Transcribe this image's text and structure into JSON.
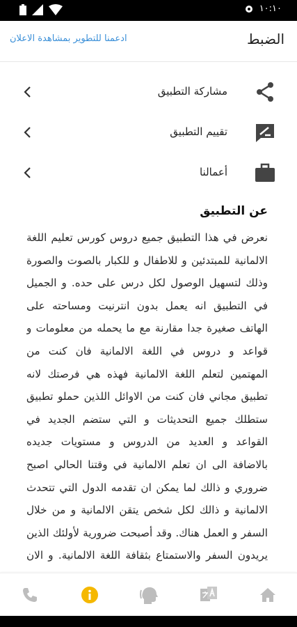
{
  "status_bar": {
    "time": "١٠:١٠"
  },
  "app_bar": {
    "title": "الضبط",
    "ad_link": "ادعمنا للتطوير بمشاهدة الاعلان"
  },
  "menu": [
    {
      "label": "مشاركة التطبيق",
      "icon": "share-icon"
    },
    {
      "label": "تقييم التطبيق",
      "icon": "rate-icon"
    },
    {
      "label": "أعمالنا",
      "icon": "briefcase-icon"
    }
  ],
  "about": {
    "title": "عن التطبيق",
    "body": "نعرض في هذا التطبيق جميع دروس كورس تعليم اللغة الالمانية للمبتدئين و للاطفال و للكبار بالصوت والصورة وذلك لتسهيل الوصول لكل درس على حده. و الجميل في التطبيق انه يعمل بدون انترنيت ومساحته على الهاتف صغيرة جدا مقارنة مع ما يحمله من معلومات و قواعد و دروس في اللغة الالمانية فان كنت من المهتمين لتعلم اللغة الالمانية فهذه هي فرصتك لانه تطبيق مجاني فان كنت من الاوائل اللذين حملو تطبيق ستطلك جميع التحديثات و التي ستضم الجديد في القواعد و العديد من الدروس و مستويات جديده بالاضافة الى ان تعلم الالمانية في وقتنا الحالي اصبح ضروري و ذالك لما يمكن ان تقدمه الدول التي تتحدث الالمانية و ذالك لكل شخص يتقن الالمانية و من خلال السفر و العمل هناك. وقد أصبحت ضرورية لأولئك الذين يريدون السفر والاستمتاع بثقافة اللغة الالمانية. و الان اتركيكم مع خصائص التطبيق الكثيرة لكن لعدم تشتيت انتباهكم ذكرنا القليل منها و الاستماع للغة الحقيقية للتطبيق خصائص التطبيق"
  },
  "colors": {
    "accent": "#f5b800",
    "link": "#3a8fd8",
    "icon": "#444444",
    "nav_icon": "#bdbdbd"
  },
  "bottom_nav": [
    {
      "name": "home-icon",
      "active": false
    },
    {
      "name": "translate-icon",
      "active": false
    },
    {
      "name": "speaking-icon",
      "active": false
    },
    {
      "name": "info-icon",
      "active": true
    },
    {
      "name": "phone-icon",
      "active": false
    }
  ]
}
